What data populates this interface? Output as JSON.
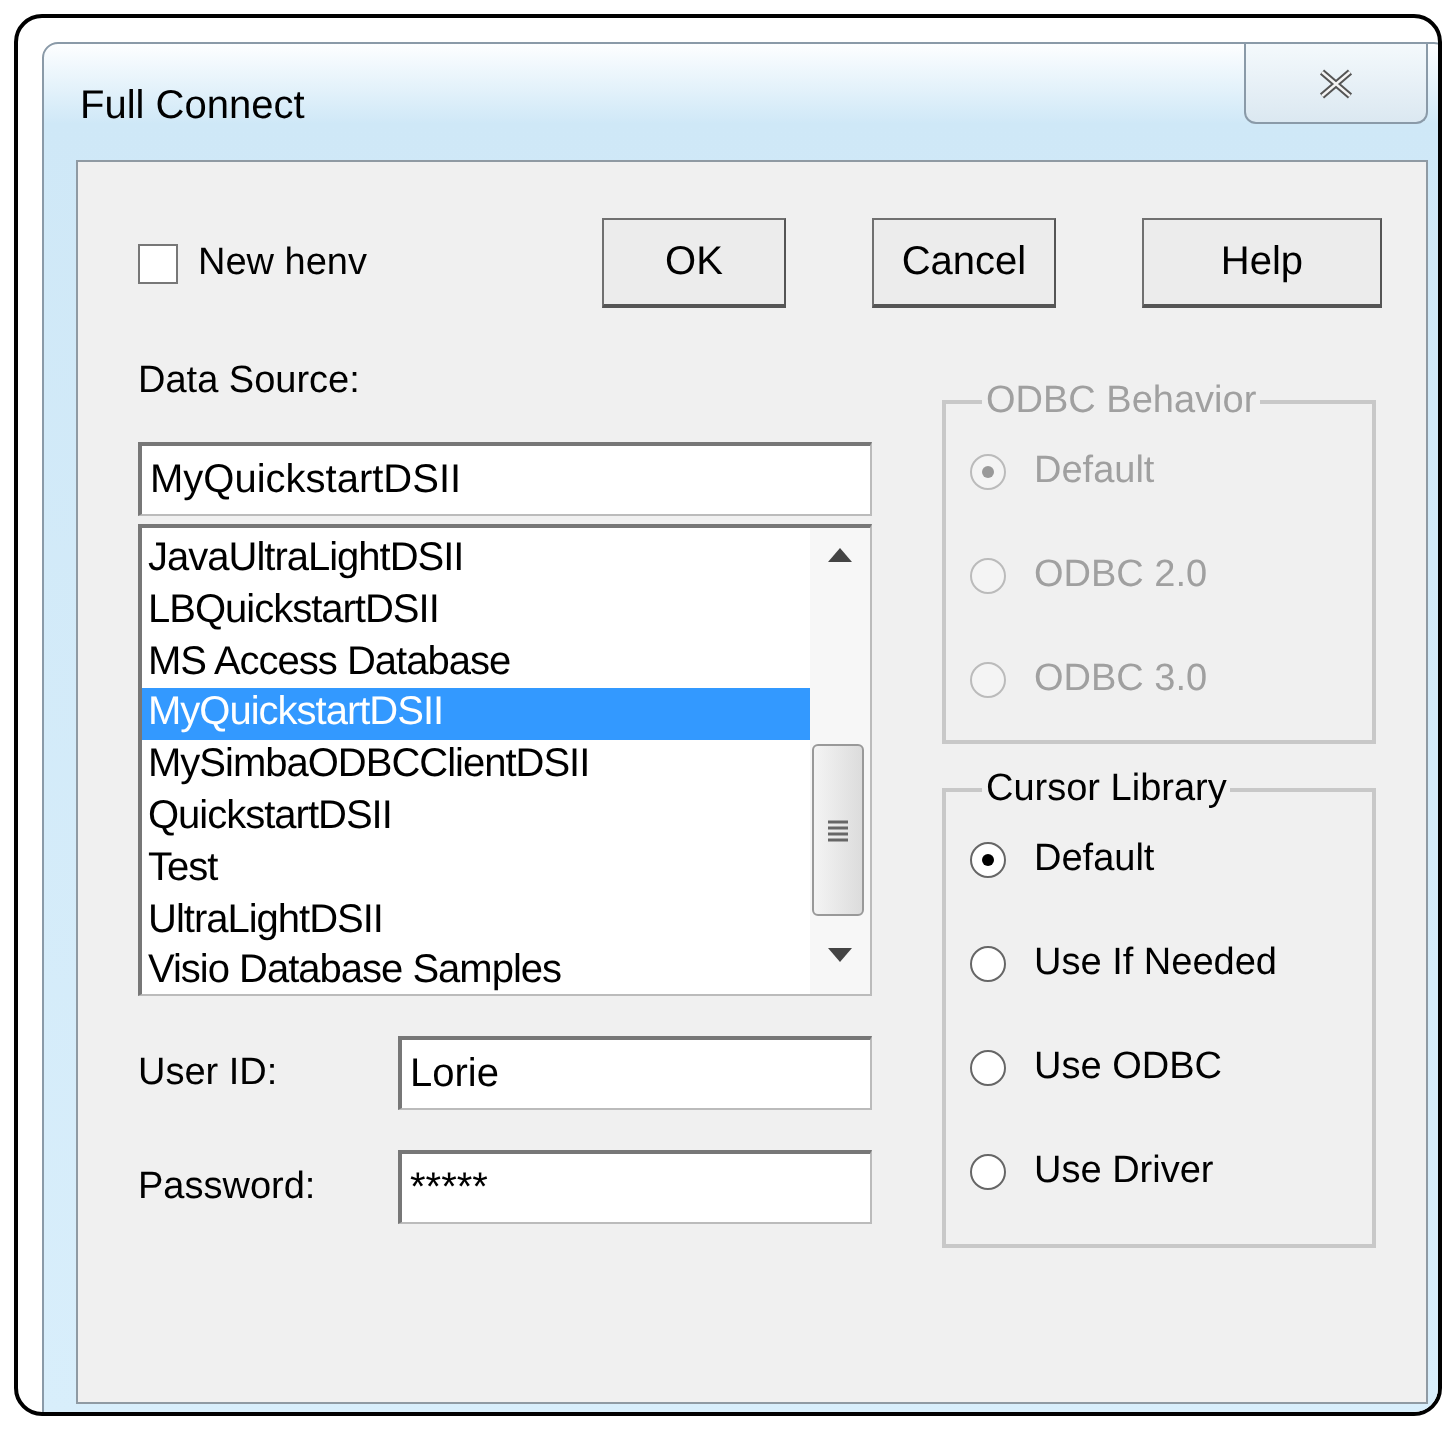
{
  "window": {
    "title": "Full Connect"
  },
  "new_henv": {
    "label": "New henv",
    "checked": false
  },
  "buttons": [
    {
      "label": "OK"
    },
    {
      "label": "Cancel"
    },
    {
      "label": "Help"
    }
  ],
  "data_source": {
    "label": "Data Source:",
    "value": "MyQuickstartDSII",
    "items": [
      {
        "label": "JavaUltraLightDSII",
        "selected": false
      },
      {
        "label": "LBQuickstartDSII",
        "selected": false
      },
      {
        "label": "MS Access Database",
        "selected": false
      },
      {
        "label": "MyQuickstartDSII",
        "selected": true
      },
      {
        "label": "MySimbaODBCClientDSII",
        "selected": false
      },
      {
        "label": "QuickstartDSII",
        "selected": false
      },
      {
        "label": "Test",
        "selected": false
      },
      {
        "label": "UltraLightDSII",
        "selected": false
      },
      {
        "label": "Visio Database Samples",
        "selected": false
      }
    ]
  },
  "odbc_behavior": {
    "title": "ODBC Behavior",
    "disabled": true,
    "options": [
      {
        "label": "Default",
        "selected": true
      },
      {
        "label": "ODBC 2.0",
        "selected": false
      },
      {
        "label": "ODBC 3.0",
        "selected": false
      }
    ]
  },
  "cursor_library": {
    "title": "Cursor Library",
    "disabled": false,
    "options": [
      {
        "label": "Default",
        "selected": true
      },
      {
        "label": "Use If Needed",
        "selected": false
      },
      {
        "label": "Use ODBC",
        "selected": false
      },
      {
        "label": "Use Driver",
        "selected": false
      }
    ]
  },
  "user_id": {
    "label": "User ID:",
    "value": "Lorie"
  },
  "password": {
    "label": "Password:",
    "value": "*****"
  }
}
